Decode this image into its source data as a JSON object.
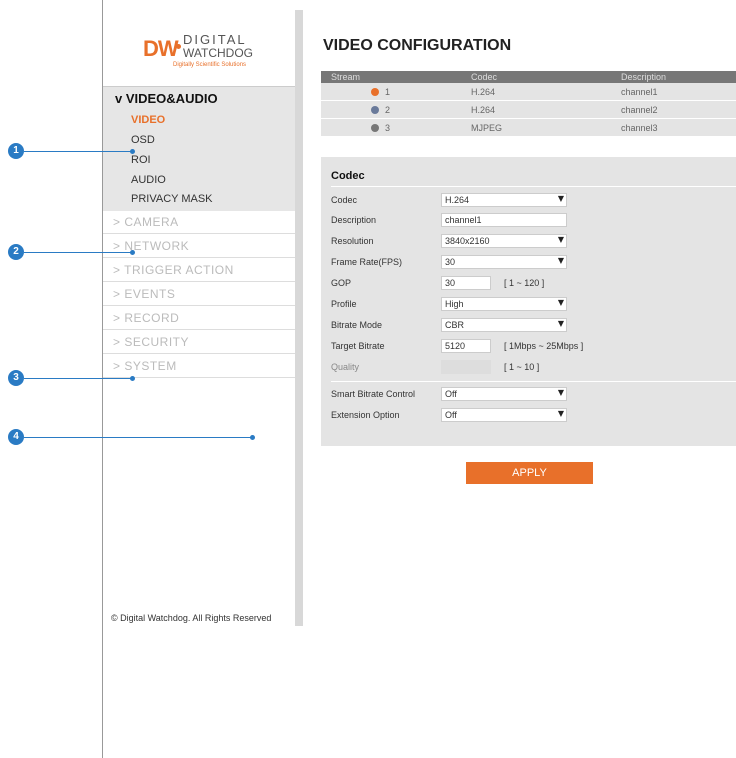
{
  "logo": {
    "brand_mark": "DW",
    "line1": "DIGITAL",
    "line2": "WATCHDOG",
    "tagline": "Digitally Scientific Solutions"
  },
  "sidebar": {
    "section_title": "v VIDEO&AUDIO",
    "subitems": [
      {
        "label": "VIDEO",
        "active": true
      },
      {
        "label": "OSD",
        "active": false
      },
      {
        "label": "ROI",
        "active": false
      },
      {
        "label": "AUDIO",
        "active": false
      },
      {
        "label": "PRIVACY MASK",
        "active": false
      }
    ],
    "menu": [
      {
        "label": "> CAMERA"
      },
      {
        "label": "> NETWORK"
      },
      {
        "label": "> TRIGGER ACTION"
      },
      {
        "label": "> EVENTS"
      },
      {
        "label": "> RECORD"
      },
      {
        "label": "> SECURITY"
      },
      {
        "label": "> SYSTEM"
      }
    ],
    "copyright": "© Digital Watchdog. All Rights Reserved"
  },
  "callouts": [
    "1",
    "2",
    "3",
    "4"
  ],
  "colors": {
    "accent": "#e8702a",
    "callout": "#2a7bc4"
  },
  "page_title": "VIDEO CONFIGURATION",
  "stream_table": {
    "headers": [
      "Stream",
      "Codec",
      "Description"
    ],
    "rows": [
      {
        "stream": "1",
        "codec": "H.264",
        "description": "channel1",
        "dot_color": "#e8702a"
      },
      {
        "stream": "2",
        "codec": "H.264",
        "description": "channel2",
        "dot_color": "#6a7a9a"
      },
      {
        "stream": "3",
        "codec": "MJPEG",
        "description": "channel3",
        "dot_color": "#777777"
      }
    ]
  },
  "codec_panel": {
    "title": "Codec",
    "codec": {
      "label": "Codec",
      "value": "H.264"
    },
    "description": {
      "label": "Description",
      "value": "channel1"
    },
    "resolution": {
      "label": "Resolution",
      "value": "3840x2160"
    },
    "frame_rate": {
      "label": "Frame Rate(FPS)",
      "value": "30"
    },
    "gop": {
      "label": "GOP",
      "value": "30",
      "hint": "[ 1 ~ 120 ]"
    },
    "profile": {
      "label": "Profile",
      "value": "High"
    },
    "bitrate_mode": {
      "label": "Bitrate Mode",
      "value": "CBR"
    },
    "target_bitrate": {
      "label": "Target Bitrate",
      "value": "5120",
      "hint": "[ 1Mbps ~ 25Mbps ]"
    },
    "quality": {
      "label": "Quality",
      "value": "",
      "hint": "[ 1 ~ 10 ]"
    },
    "smart_bitrate": {
      "label": "Smart Bitrate Control",
      "value": "Off"
    },
    "extension_option": {
      "label": "Extension Option",
      "value": "Off"
    }
  },
  "apply_label": "APPLY",
  "dropdown_icon": "triangle-down-icon"
}
